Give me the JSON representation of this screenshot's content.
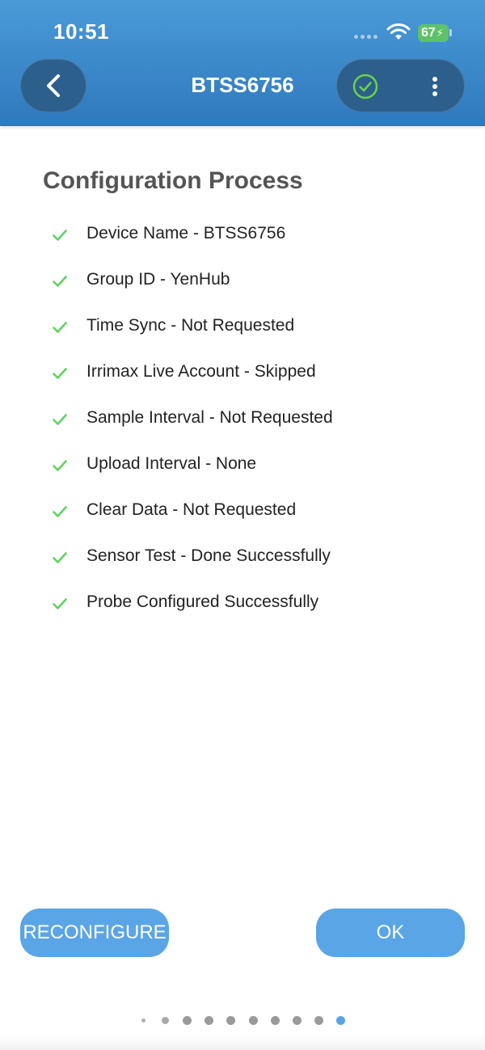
{
  "status_bar": {
    "time": "10:51",
    "battery": "67"
  },
  "header": {
    "title": "BTSS6756"
  },
  "main": {
    "section_title": "Configuration Process",
    "steps": [
      {
        "label": "Device Name - BTSS6756",
        "done": true
      },
      {
        "label": "Group ID - YenHub",
        "done": true
      },
      {
        "label": "Time Sync - Not Requested",
        "done": true
      },
      {
        "label": "Irrimax Live Account - Skipped",
        "done": true
      },
      {
        "label": "Sample Interval - Not Requested",
        "done": true
      },
      {
        "label": "Upload Interval - None",
        "done": true
      },
      {
        "label": "Clear Data - Not Requested",
        "done": true
      },
      {
        "label": "Sensor Test - Done Successfully",
        "done": true
      },
      {
        "label": "Probe Configured Successfully",
        "done": true
      }
    ]
  },
  "buttons": {
    "reconfigure": "RECONFIGURE",
    "ok": "OK"
  },
  "pager": {
    "page_count": 10,
    "current_page": 10
  },
  "colors": {
    "header": "#3a88cc",
    "accent": "#5aa5e6",
    "check": "#5fd35f"
  }
}
